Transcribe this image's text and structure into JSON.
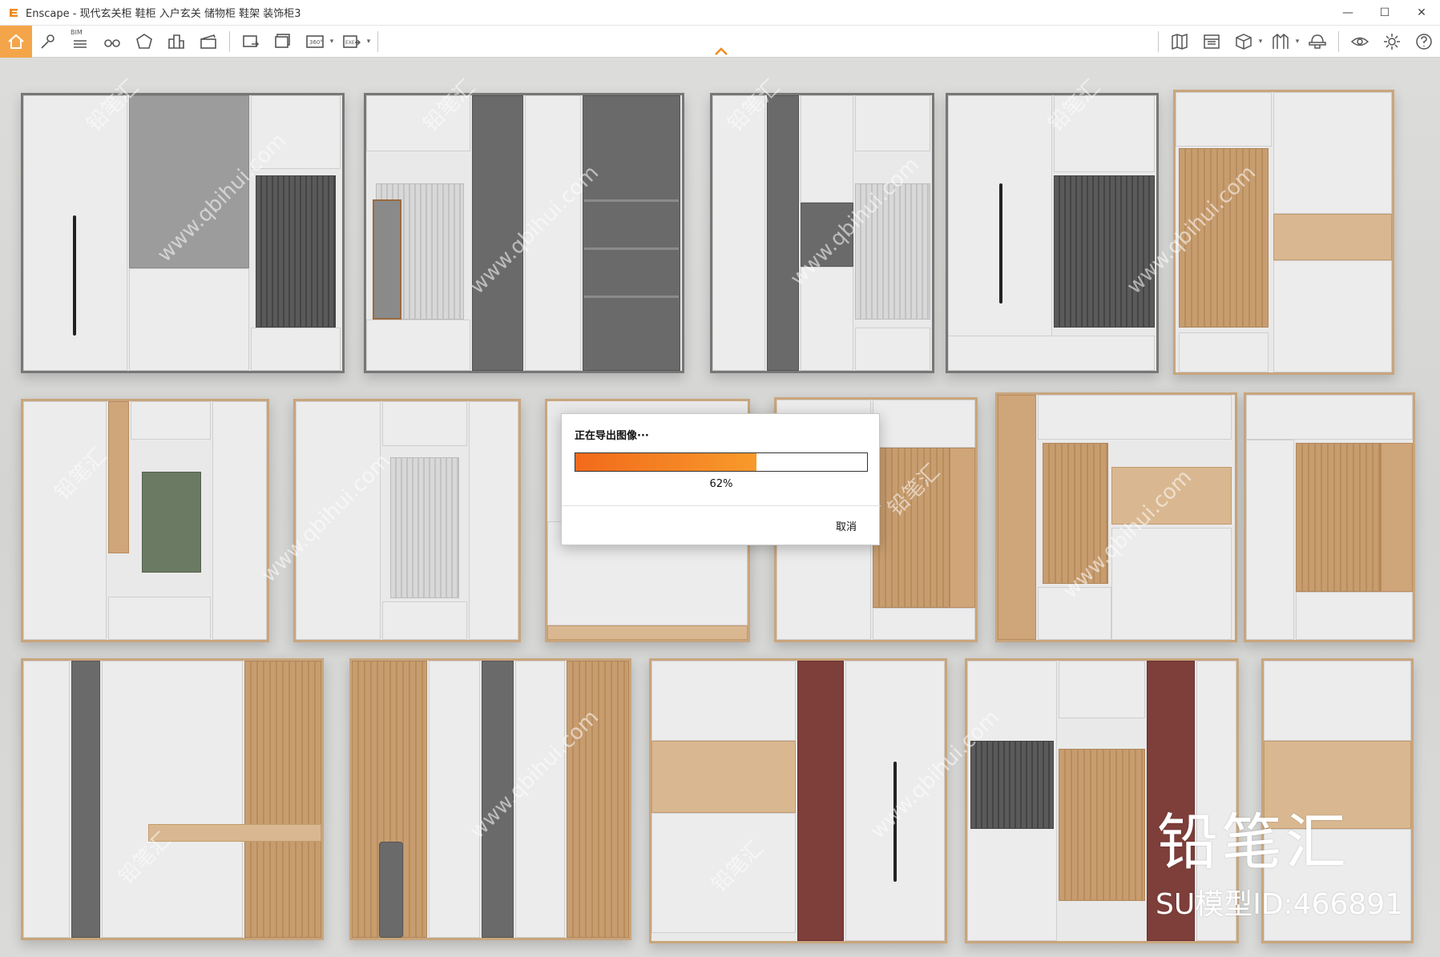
{
  "window": {
    "title": "Enscape - 现代玄关柜 鞋柜 入户玄关 储物柜 鞋架 装饰柜3",
    "minimize_label": "—",
    "maximize_label": "☐",
    "close_label": "✕"
  },
  "toolbar": {
    "bim_label": "BIM",
    "left_buttons": [
      "home-icon",
      "map-pin-icon",
      "bim-list-icon",
      "binoculars-icon",
      "perspective-icon",
      "buildings-icon",
      "clapper-icon",
      "screenshot-icon",
      "batch-render-icon",
      "panorama-360-icon",
      "exe-export-icon"
    ],
    "right_buttons": [
      "map-icon",
      "asset-library-icon",
      "cube-view-icon",
      "material-icon",
      "hat-icon",
      "visual-settings-icon",
      "gear-icon",
      "help-icon"
    ],
    "panorama_label": "360°",
    "exe_label": "EXE"
  },
  "dialog": {
    "title": "正在导出图像···",
    "progress_percent": 62,
    "progress_text": "62%",
    "cancel_label": "取消"
  },
  "watermark": {
    "logo_text": "铅笔汇",
    "id_text": "SU模型ID:466891",
    "diag_text_cn": "铅笔汇",
    "diag_text_url": "www.qbihui.com"
  },
  "colors": {
    "accent": "#f4a54a",
    "progress_start": "#f26a1b",
    "progress_end": "#f79a2b"
  }
}
